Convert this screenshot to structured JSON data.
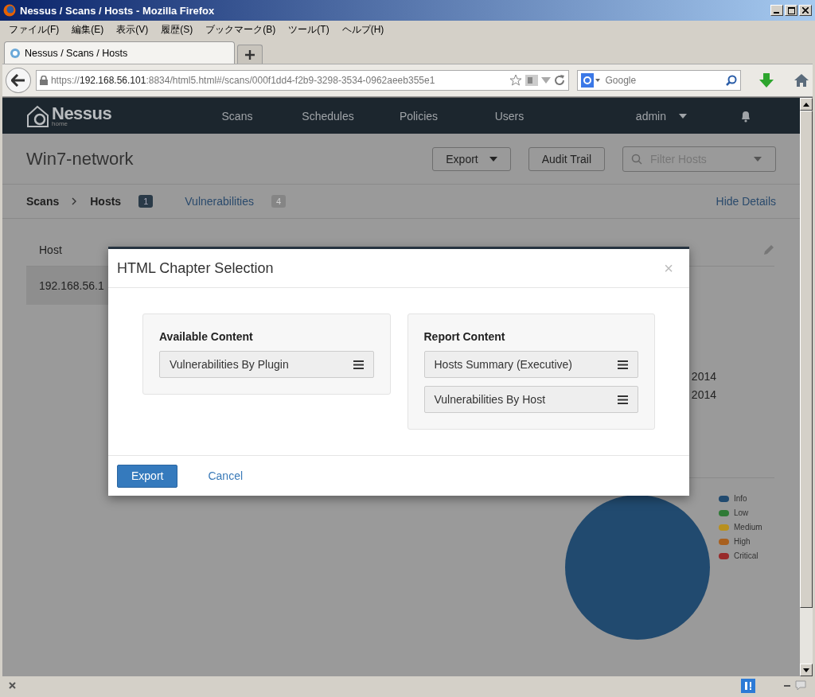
{
  "window": {
    "title": "Nessus / Scans / Hosts - Mozilla Firefox"
  },
  "menu": [
    "ファイル(F)",
    "編集(E)",
    "表示(V)",
    "履歴(S)",
    "ブックマーク(B)",
    "ツール(T)",
    "ヘルプ(H)"
  ],
  "tabs": [
    {
      "label": "Nessus / Scans / Hosts",
      "selected": true
    }
  ],
  "address_bar": {
    "scheme": "https://",
    "host": "192.168.56.101",
    "rest": ":8834/html5.html#/scans/000f1dd4-f2b9-3298-3534-0962aeeb355e1"
  },
  "search": {
    "placeholder": "Google"
  },
  "app": {
    "brand": "Nessus",
    "brand_sub": "home",
    "nav": [
      "Scans",
      "Schedules",
      "Policies",
      "Users"
    ],
    "user": "admin"
  },
  "scan": {
    "title": "Win7-network",
    "export": "Export",
    "audit": "Audit Trail",
    "filter": {
      "placeholder": "Filter Hosts"
    }
  },
  "breadcrumb": {
    "root": "Scans",
    "tabs": [
      {
        "label": "Hosts",
        "badge": "1",
        "selected": true
      },
      {
        "label": "Vulnerabilities",
        "badge": "4",
        "selected": false
      }
    ],
    "hide_details": "Hide Details"
  },
  "table": {
    "columns": [
      "Host"
    ],
    "rows": [
      [
        "192.168.56.1"
      ]
    ]
  },
  "details": {
    "lines": [
      "2014",
      "2014"
    ]
  },
  "legend": [
    {
      "label": "Info",
      "color": "#214a6f"
    },
    {
      "label": "Low",
      "color": "#2f7a36"
    },
    {
      "label": "Medium",
      "color": "#b8901f"
    },
    {
      "label": "High",
      "color": "#a8601f"
    },
    {
      "label": "Critical",
      "color": "#982a2a"
    }
  ],
  "modal": {
    "title": "HTML Chapter Selection",
    "close": "×",
    "panels": [
      {
        "heading": "Available Content",
        "items": [
          "Vulnerabilities By Plugin"
        ]
      },
      {
        "heading": "Report Content",
        "items": [
          "Hosts Summary (Executive)",
          "Vulnerabilities By Host"
        ]
      }
    ],
    "primary": "Export",
    "secondary": "Cancel"
  }
}
